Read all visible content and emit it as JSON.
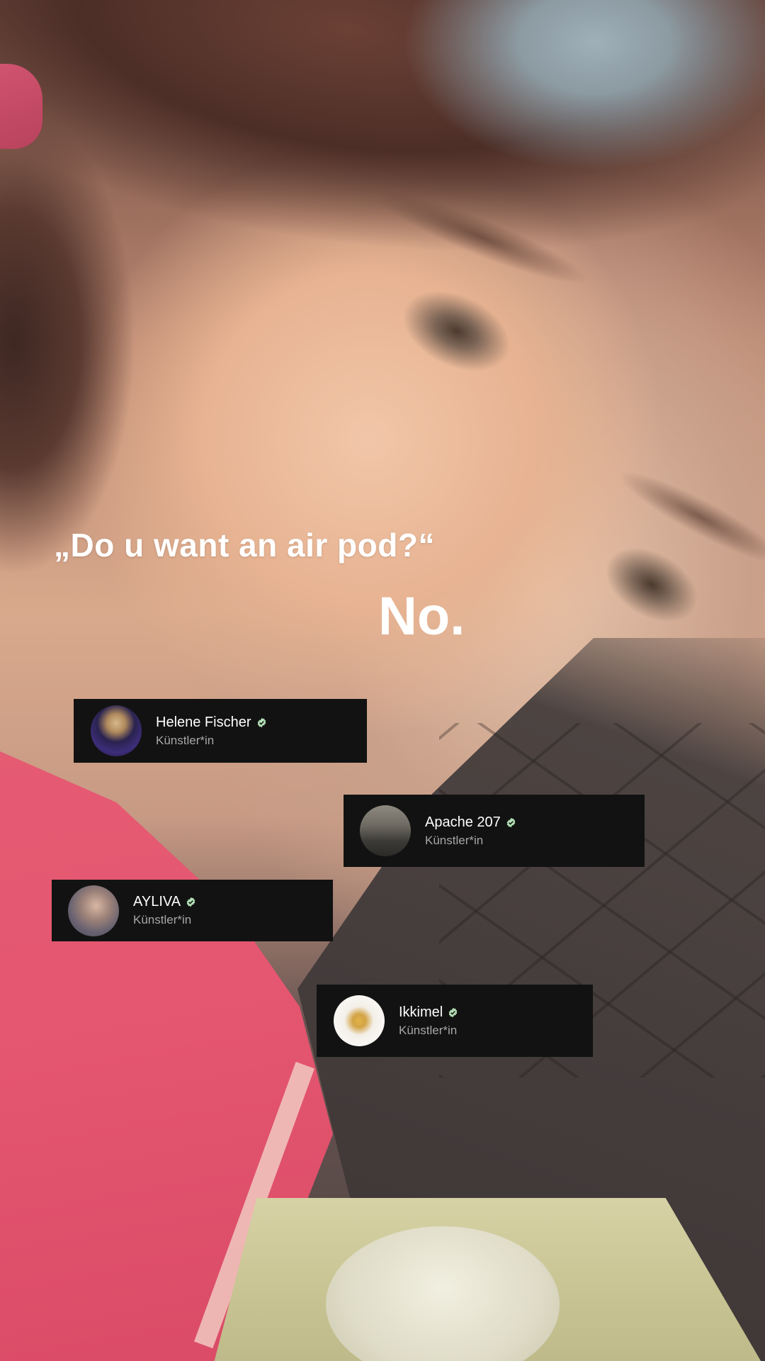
{
  "caption": {
    "quote": "„Do u want an air pod?“",
    "answer": "No."
  },
  "artists": [
    {
      "name": "Helene Fischer",
      "role": "Künstler*in",
      "verified": true
    },
    {
      "name": "Apache 207",
      "role": "Künstler*in",
      "verified": true
    },
    {
      "name": "AYLIVA",
      "role": "Künstler*in",
      "verified": true
    },
    {
      "name": "Ikkimel",
      "role": "Künstler*in",
      "verified": true
    }
  ],
  "colors": {
    "card_background": "#121212",
    "verified_badge": "#b3e0b5",
    "caption_text": "#ffffff"
  }
}
